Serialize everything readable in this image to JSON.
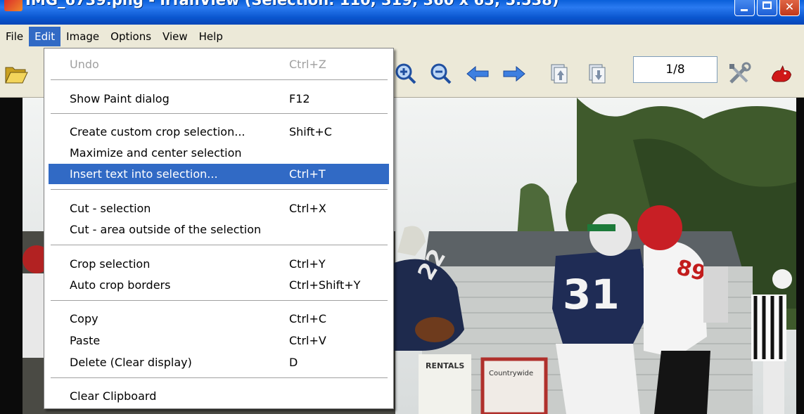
{
  "window": {
    "title": "IMG_6739.png - IrfanView (Selection: 110, 319; 360 x 65; 5.538)"
  },
  "menubar": {
    "items": [
      {
        "label": "File"
      },
      {
        "label": "Edit"
      },
      {
        "label": "Image"
      },
      {
        "label": "Options"
      },
      {
        "label": "View"
      },
      {
        "label": "Help"
      }
    ],
    "active": "Edit"
  },
  "toolbar": {
    "icons": [
      "open-folder-icon",
      "zoom-in-icon",
      "zoom-out-icon",
      "previous-arrow-icon",
      "next-arrow-icon",
      "first-page-icon",
      "last-page-icon",
      "settings-tools-icon",
      "irfanview-cat-icon"
    ],
    "page_indicator": "1/8"
  },
  "edit_menu": {
    "items": [
      {
        "label": "Undo",
        "shortcut": "Ctrl+Z",
        "disabled": true
      },
      {
        "label": "Show Paint dialog",
        "shortcut": "F12"
      },
      {
        "label": "Create custom crop selection...",
        "shortcut": "Shift+C"
      },
      {
        "label": "Maximize and center selection",
        "shortcut": ""
      },
      {
        "label": "Insert text into selection...",
        "shortcut": "Ctrl+T",
        "highlighted": true
      },
      {
        "label": "Cut - selection",
        "shortcut": "Ctrl+X"
      },
      {
        "label": "Cut - area outside of the selection",
        "shortcut": ""
      },
      {
        "label": "Crop selection",
        "shortcut": "Ctrl+Y"
      },
      {
        "label": "Auto crop borders",
        "shortcut": "Ctrl+Shift+Y"
      },
      {
        "label": "Copy",
        "shortcut": "Ctrl+C"
      },
      {
        "label": "Paste",
        "shortcut": "Ctrl+V"
      },
      {
        "label": "Delete (Clear display)",
        "shortcut": "D"
      },
      {
        "label": "Clear Clipboard",
        "shortcut": ""
      }
    ]
  },
  "photo": {
    "jersey_numbers": [
      "22",
      "31",
      "89"
    ],
    "signs": [
      "RENTALS",
      "Countrywide"
    ]
  },
  "colors": {
    "titlebar": "#0b57d0",
    "highlight": "#316ac5",
    "menu_background": "#ece9d8"
  }
}
